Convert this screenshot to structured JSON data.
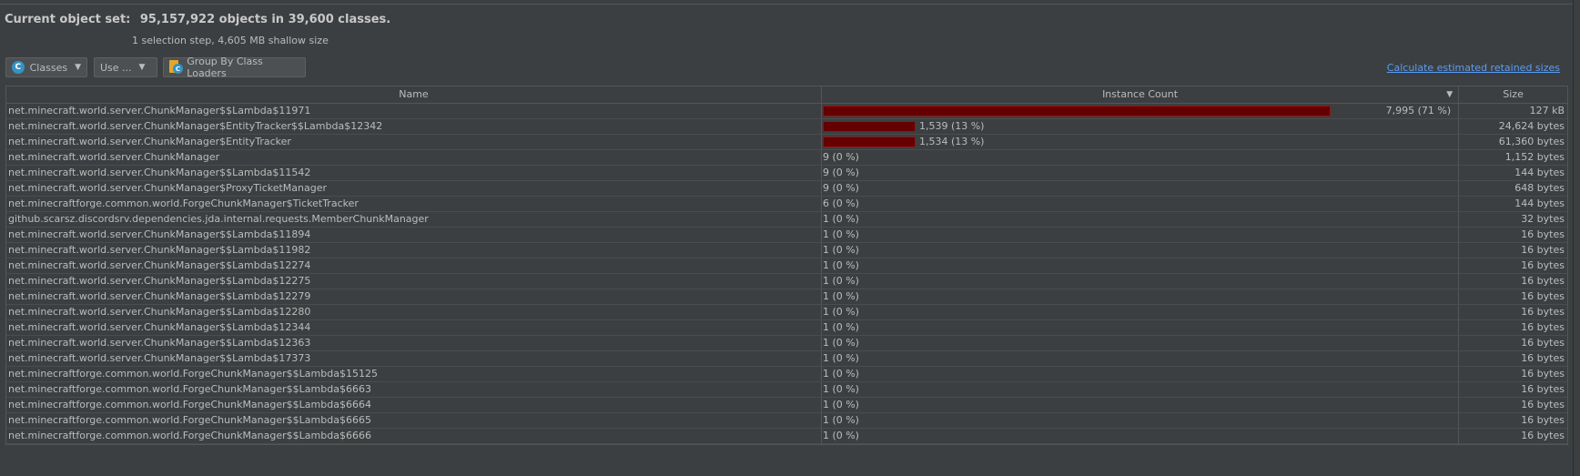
{
  "header": {
    "label": "Current object set:",
    "summary": "95,157,922 objects in 39,600 classes.",
    "subtitle": "1 selection step, 4,605 MB shallow size"
  },
  "toolbar": {
    "view_select": "Classes",
    "use_dropdown": "Use ...",
    "group_button": "Group By Class Loaders",
    "calc_link": "Calculate estimated retained sizes"
  },
  "table": {
    "columns": [
      "Name",
      "Instance Count",
      "Size"
    ],
    "sorted_column": "Instance Count",
    "rows": [
      {
        "name": "net.minecraft.world.server.ChunkManager$$Lambda$11971",
        "count": "7,995 (71 %)",
        "share": 0.71,
        "size": "127 kB"
      },
      {
        "name": "net.minecraft.world.server.ChunkManager$EntityTracker$$Lambda$12342",
        "count": "1,539 (13 %)",
        "share": 0.13,
        "size": "24,624 bytes"
      },
      {
        "name": "net.minecraft.world.server.ChunkManager$EntityTracker",
        "count": "1,534 (13 %)",
        "share": 0.13,
        "size": "61,360 bytes"
      },
      {
        "name": "net.minecraft.world.server.ChunkManager",
        "count": "9 (0 %)",
        "share": 0,
        "size": "1,152 bytes"
      },
      {
        "name": "net.minecraft.world.server.ChunkManager$$Lambda$11542",
        "count": "9 (0 %)",
        "share": 0,
        "size": "144 bytes"
      },
      {
        "name": "net.minecraft.world.server.ChunkManager$ProxyTicketManager",
        "count": "9 (0 %)",
        "share": 0,
        "size": "648 bytes"
      },
      {
        "name": "net.minecraftforge.common.world.ForgeChunkManager$TicketTracker",
        "count": "6 (0 %)",
        "share": 0,
        "size": "144 bytes"
      },
      {
        "name": "github.scarsz.discordsrv.dependencies.jda.internal.requests.MemberChunkManager",
        "count": "1 (0 %)",
        "share": 0,
        "size": "32 bytes"
      },
      {
        "name": "net.minecraft.world.server.ChunkManager$$Lambda$11894",
        "count": "1 (0 %)",
        "share": 0,
        "size": "16 bytes"
      },
      {
        "name": "net.minecraft.world.server.ChunkManager$$Lambda$11982",
        "count": "1 (0 %)",
        "share": 0,
        "size": "16 bytes"
      },
      {
        "name": "net.minecraft.world.server.ChunkManager$$Lambda$12274",
        "count": "1 (0 %)",
        "share": 0,
        "size": "16 bytes"
      },
      {
        "name": "net.minecraft.world.server.ChunkManager$$Lambda$12275",
        "count": "1 (0 %)",
        "share": 0,
        "size": "16 bytes"
      },
      {
        "name": "net.minecraft.world.server.ChunkManager$$Lambda$12279",
        "count": "1 (0 %)",
        "share": 0,
        "size": "16 bytes"
      },
      {
        "name": "net.minecraft.world.server.ChunkManager$$Lambda$12280",
        "count": "1 (0 %)",
        "share": 0,
        "size": "16 bytes"
      },
      {
        "name": "net.minecraft.world.server.ChunkManager$$Lambda$12344",
        "count": "1 (0 %)",
        "share": 0,
        "size": "16 bytes"
      },
      {
        "name": "net.minecraft.world.server.ChunkManager$$Lambda$12363",
        "count": "1 (0 %)",
        "share": 0,
        "size": "16 bytes"
      },
      {
        "name": "net.minecraft.world.server.ChunkManager$$Lambda$17373",
        "count": "1 (0 %)",
        "share": 0,
        "size": "16 bytes"
      },
      {
        "name": "net.minecraftforge.common.world.ForgeChunkManager$$Lambda$15125",
        "count": "1 (0 %)",
        "share": 0,
        "size": "16 bytes"
      },
      {
        "name": "net.minecraftforge.common.world.ForgeChunkManager$$Lambda$6663",
        "count": "1 (0 %)",
        "share": 0,
        "size": "16 bytes"
      },
      {
        "name": "net.minecraftforge.common.world.ForgeChunkManager$$Lambda$6664",
        "count": "1 (0 %)",
        "share": 0,
        "size": "16 bytes"
      },
      {
        "name": "net.minecraftforge.common.world.ForgeChunkManager$$Lambda$6665",
        "count": "1 (0 %)",
        "share": 0,
        "size": "16 bytes"
      },
      {
        "name": "net.minecraftforge.common.world.ForgeChunkManager$$Lambda$6666",
        "count": "1 (0 %)",
        "share": 0,
        "size": "16 bytes"
      }
    ]
  },
  "colors": {
    "background": "#3c3f41",
    "bar_fill": "#650000",
    "link": "#589df6",
    "class_icon": "#3592c4",
    "loader_icon": "#e3a72b"
  },
  "icons": {
    "view_select": "class-c-icon",
    "group_button": "class-loader-icon",
    "dropdown": "chevron-down-icon",
    "sort": "sort-descending-icon"
  }
}
